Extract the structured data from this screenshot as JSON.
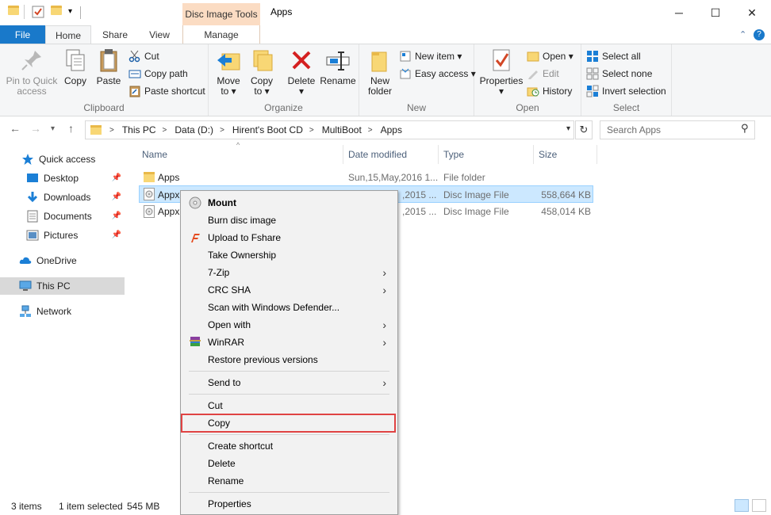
{
  "window": {
    "title": "Apps",
    "tools_tab": "Disc Image Tools",
    "minimize": "─",
    "maximize": "☐",
    "close": "✕"
  },
  "ribbon_tabs": {
    "file": "File",
    "home": "Home",
    "share": "Share",
    "view": "View",
    "manage": "Manage"
  },
  "ribbon": {
    "clipboard": {
      "label": "Clipboard",
      "pin_line1": "Pin to Quick",
      "pin_line2": "access",
      "copy": "Copy",
      "paste": "Paste",
      "cut": "Cut",
      "copy_path": "Copy path",
      "paste_shortcut": "Paste shortcut"
    },
    "organize": {
      "label": "Organize",
      "move_line1": "Move",
      "move_line2": "to ▾",
      "copy_line1": "Copy",
      "copy_line2": "to ▾",
      "delete_line1": "Delete",
      "delete_line2": "▾",
      "rename": "Rename"
    },
    "new": {
      "label": "New",
      "new_folder_line1": "New",
      "new_folder_line2": "folder",
      "new_item": "New item ▾",
      "easy_access": "Easy access ▾"
    },
    "open": {
      "label": "Open",
      "properties_line1": "Properties",
      "properties_line2": "▾",
      "open": "Open ▾",
      "edit": "Edit",
      "history": "History"
    },
    "select": {
      "label": "Select",
      "select_all": "Select all",
      "select_none": "Select none",
      "invert_selection": "Invert selection"
    }
  },
  "address": {
    "crumbs": [
      "This PC",
      "Data (D:)",
      "Hirent's Boot CD",
      "MultiBoot",
      "Apps"
    ],
    "search_placeholder": "Search Apps"
  },
  "navpane": {
    "quick_access": "Quick access",
    "desktop": "Desktop",
    "downloads": "Downloads",
    "documents": "Documents",
    "pictures": "Pictures",
    "onedrive": "OneDrive",
    "this_pc": "This PC",
    "network": "Network"
  },
  "columns": {
    "name": "Name",
    "date": "Date modified",
    "type": "Type",
    "size": "Size"
  },
  "files": [
    {
      "name": "Apps",
      "date": "Sun,15,May,2016 1...",
      "type": "File folder",
      "size": ""
    },
    {
      "name": "Appx",
      "date": ",2015 ...",
      "type": "Disc Image File",
      "size": "558,664 KB"
    },
    {
      "name": "Appx",
      "date": ",2015 ...",
      "type": "Disc Image File",
      "size": "458,014 KB"
    }
  ],
  "context_menu": {
    "mount": "Mount",
    "burn": "Burn disc image",
    "upload": "Upload to Fshare",
    "take_ownership": "Take Ownership",
    "zip": "7-Zip",
    "crc": "CRC SHA",
    "scan": "Scan with Windows Defender...",
    "open_with": "Open with",
    "winrar": "WinRAR",
    "restore": "Restore previous versions",
    "send_to": "Send to",
    "cut": "Cut",
    "copy": "Copy",
    "create_shortcut": "Create shortcut",
    "delete": "Delete",
    "rename": "Rename",
    "properties": "Properties"
  },
  "status": {
    "items": "3 items",
    "selected": "1 item selected",
    "size": "545 MB"
  },
  "colors": {
    "accent": "#1979ca",
    "tools_tab": "#fbdcc3",
    "selection": "#cce8ff",
    "highlight_box": "#e04343"
  }
}
